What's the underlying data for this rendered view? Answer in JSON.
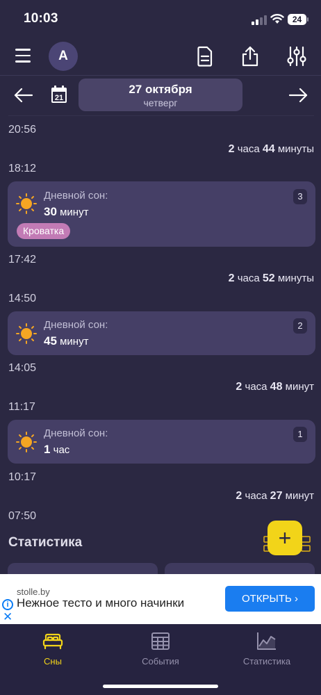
{
  "status": {
    "time": "10:03",
    "battery": "24"
  },
  "header": {
    "avatar_letter": "A"
  },
  "datebar": {
    "date": "27 октября",
    "weekday": "четверг",
    "calendar_day": "21"
  },
  "timeline": {
    "t1": "20:56",
    "d1": {
      "h": "2",
      "h_word": "часа",
      "m": "44",
      "m_word": "минуты"
    },
    "t2": "18:12",
    "card1": {
      "title": "Дневной сон:",
      "value": "30",
      "unit": "минут",
      "tag": "Кроватка",
      "badge": "3"
    },
    "t3": "17:42",
    "d2": {
      "h": "2",
      "h_word": "часа",
      "m": "52",
      "m_word": "минуты"
    },
    "t4": "14:50",
    "card2": {
      "title": "Дневной сон:",
      "value": "45",
      "unit": "минут",
      "badge": "2"
    },
    "t5": "14:05",
    "d3": {
      "h": "2",
      "h_word": "часа",
      "m": "48",
      "m_word": "минут"
    },
    "t6": "11:17",
    "card3": {
      "title": "Дневной сон:",
      "value": "1",
      "unit": "час",
      "badge": "1"
    },
    "t7": "10:17",
    "d4": {
      "h": "2",
      "h_word": "часа",
      "m": "27",
      "m_word": "минут"
    },
    "t8": "07:50"
  },
  "stats": {
    "title": "Статистика"
  },
  "fab": {
    "label": "+"
  },
  "ad": {
    "domain": "stolle.by",
    "text": "Нежное тесто и много начинки",
    "button": "ОТКРЫТЬ ›"
  },
  "tabs": [
    {
      "label": "Сны",
      "icon": "bed-icon"
    },
    {
      "label": "События",
      "icon": "calendar-grid-icon"
    },
    {
      "label": "Статистика",
      "icon": "chart-icon"
    }
  ],
  "colors": {
    "background": "#2b2842",
    "card": "#453f66",
    "accent": "#f2d419",
    "tag": "#c27bb5",
    "ad_button": "#1a7df0"
  }
}
